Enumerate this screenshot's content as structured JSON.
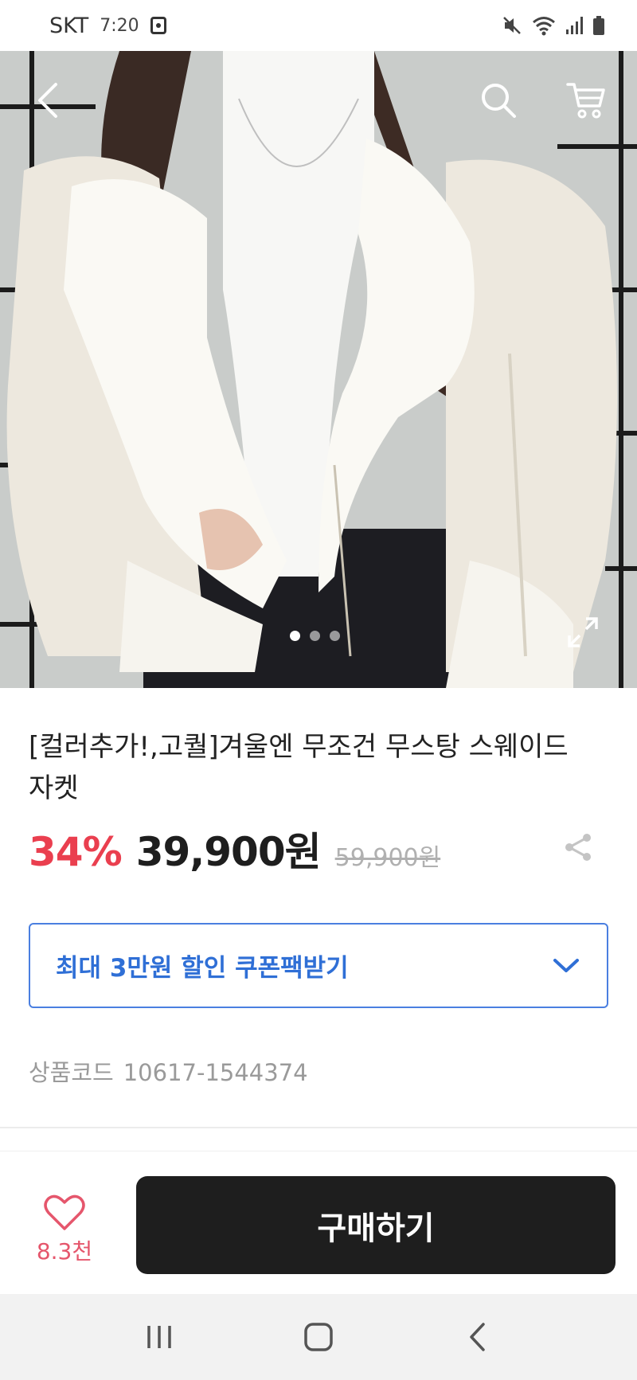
{
  "status_bar": {
    "carrier": "SKT",
    "time": "7:20",
    "icons": [
      "mute-icon",
      "wifi-icon",
      "signal-icon",
      "battery-icon"
    ]
  },
  "header": {
    "icons": [
      "back-arrow-icon",
      "search-icon",
      "cart-icon"
    ]
  },
  "gallery": {
    "total_images": 3,
    "active_index": 0
  },
  "product": {
    "title": "[컬러추가!,고퀄]겨울엔 무조건 무스탕 스웨이드 자켓",
    "discount": "34%",
    "price": "39,900원",
    "original_price": "59,900원",
    "coupon_label": "최대 3만원 할인 쿠폰팩받기",
    "code_label": "상품코드",
    "code_value": "10617-1544374"
  },
  "actions": {
    "like_count": "8.3천",
    "buy_label": "구매하기"
  },
  "colors": {
    "discount": "#ea3f4f",
    "coupon_accent": "#2f6fd6",
    "buy_button": "#1e1e1e",
    "like": "#e5566c"
  }
}
